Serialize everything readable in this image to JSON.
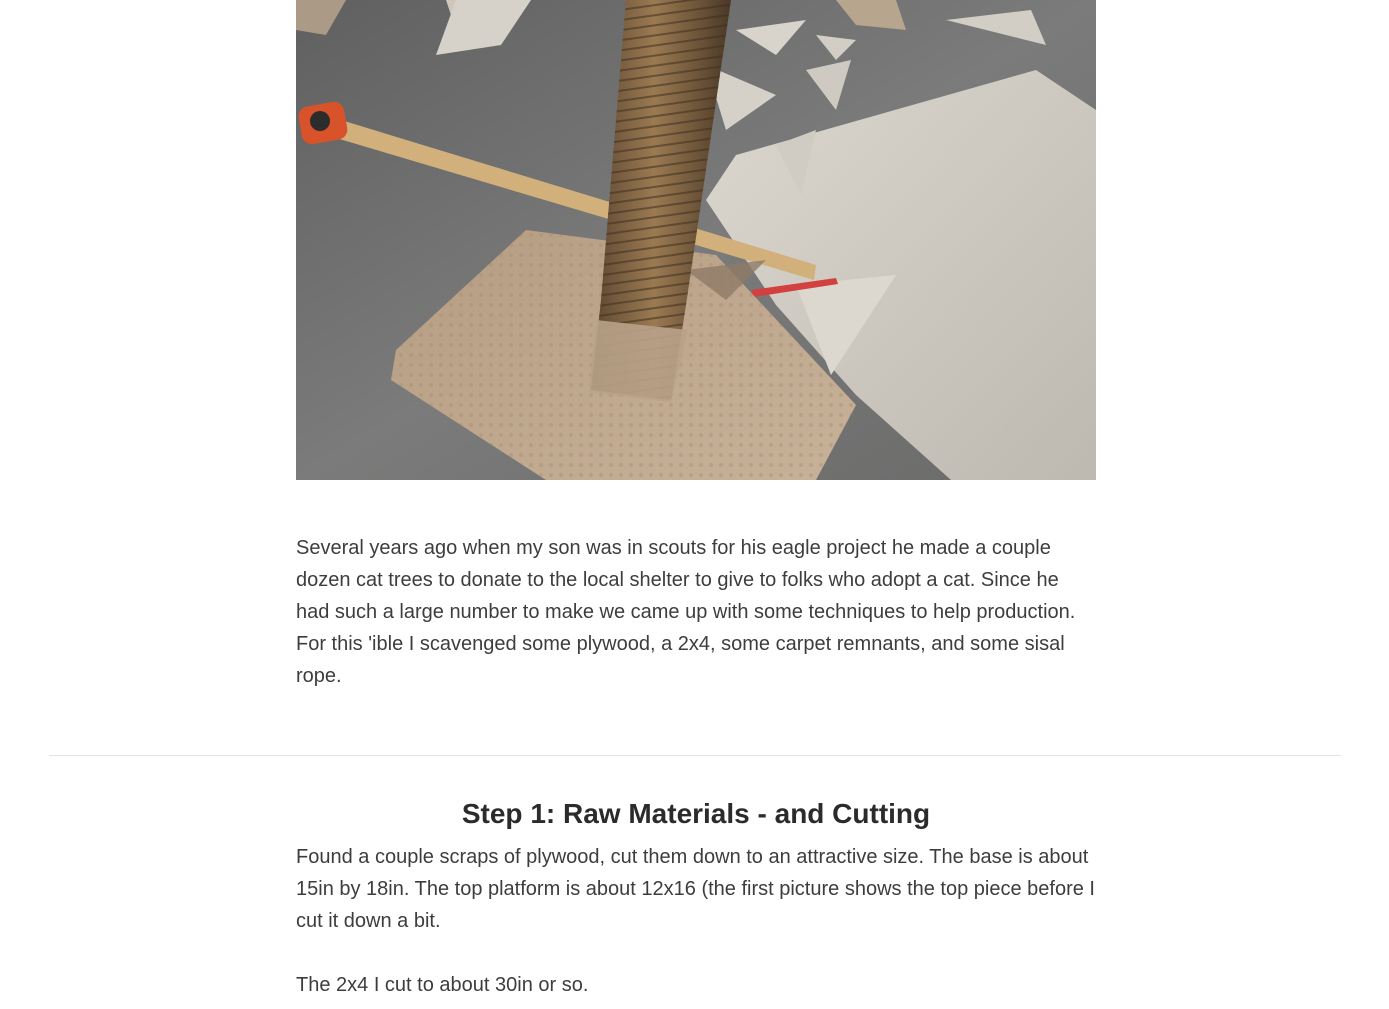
{
  "hero_image": {
    "subject": "cat-scratching-post-photo"
  },
  "intro": {
    "text": "Several years ago when my son was in scouts for his eagle project he made a couple dozen cat trees to donate to the local shelter to give to folks who adopt a cat. Since he had such a large number to make we came up with some techniques to help production. For this 'ible I scavenged some plywood, a 2x4, some carpet remnants, and some sisal rope."
  },
  "step1": {
    "title": "Step 1: Raw Materials - and Cutting",
    "paragraphs": [
      "Found a couple scraps of plywood, cut them down to an attractive size. The base is about 15in by 18in. The top platform is about 12x16 (the first picture shows the top piece before I cut it down a bit.",
      "The 2x4 I cut to about 30in or so."
    ]
  }
}
